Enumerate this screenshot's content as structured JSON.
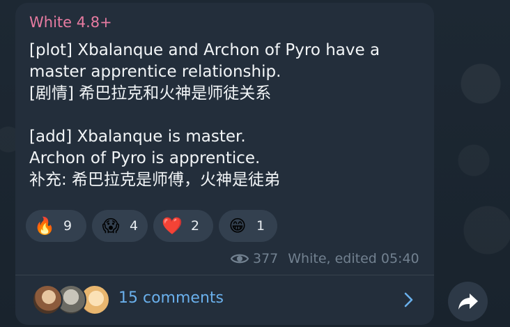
{
  "post": {
    "author": "White 4.8+",
    "lines": [
      "[plot] Xbalanque and Archon of Pyro have a",
      "master apprentice relationship.",
      "[剧情] 希巴拉克和火神是师徒关系",
      "",
      "[add] Xbalanque is master.",
      "Archon of Pyro is apprentice.",
      "补充: 希巴拉克是师傅，火神是徒弟"
    ],
    "reactions": [
      {
        "emoji": "🔥",
        "icon": "fire-icon",
        "count": "9"
      },
      {
        "emoji": "😱",
        "icon": "scream-face-icon",
        "count": "4"
      },
      {
        "emoji": "❤️",
        "icon": "red-heart-icon",
        "count": "2"
      },
      {
        "emoji": "😁",
        "icon": "grinning-face-icon",
        "count": "1"
      }
    ],
    "views": "377",
    "signature": "White, edited 05:40",
    "comments_label": "15 comments"
  },
  "colors": {
    "background": "#1b2530",
    "bubble": "#232e3b",
    "author": "#e77ba1",
    "link": "#6ab0ec",
    "meta": "#728190",
    "reaction_pill": "#33404f"
  }
}
